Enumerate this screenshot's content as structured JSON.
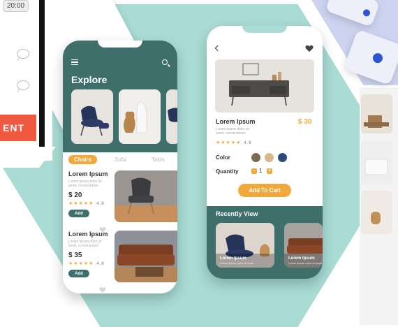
{
  "left_bg": {
    "time": "20:00",
    "banner_partial": "ENT"
  },
  "phone1": {
    "title": "Explore",
    "tabs": [
      "Chairs",
      "Sofa",
      "Table"
    ],
    "products": [
      {
        "name": "Lorem Ipsum",
        "desc": "Lorem ipsum dolor sit amet, consectetuer.",
        "price": "$ 20",
        "stars": "★★★★★",
        "rating": "4.8",
        "add_label": "Add"
      },
      {
        "name": "Lorem Ipsum",
        "desc": "Lorem ipsum dolor sit amet, consectetuer.",
        "price": "$ 35",
        "stars": "★★★★★",
        "rating": "4.8",
        "add_label": "Add"
      }
    ]
  },
  "phone2": {
    "product_name": "Lorem Ipsum",
    "price": "$ 30",
    "desc": "Lorem ipsum dolor sit amet, consectetuer.",
    "stars": "★★★★★",
    "rating": "4.8",
    "color_label": "Color",
    "colors": [
      "#7a6a52",
      "#d9b98c",
      "#2e4a7a"
    ],
    "quantity_label": "Quantity",
    "quantity_value": "1",
    "minus": "-",
    "plus": "+",
    "cart_label": "Add To Cart",
    "recent_title": "Recently View",
    "recent": [
      {
        "name": "Lorem Ipsum",
        "desc": "Lorem ipsum dolor sit amet"
      },
      {
        "name": "Lorem Ipsum",
        "desc": "Lorem ipsum dolor sit amet"
      }
    ]
  },
  "colors": {
    "teal": "#3f6f6b",
    "mint": "#a9dcd5",
    "orange": "#f2a93b"
  }
}
